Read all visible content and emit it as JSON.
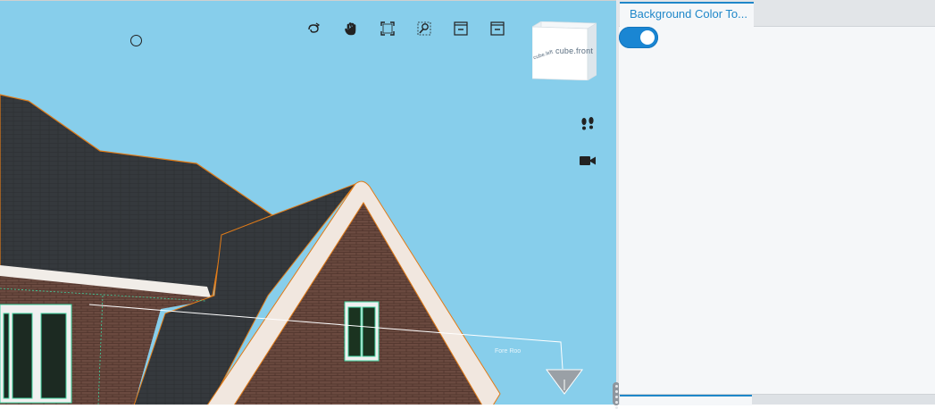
{
  "viewer": {
    "background_color": "#87ceeb",
    "nav_cube": {
      "face_label": "cube.front",
      "side_label": "cube.left"
    },
    "toolbar_icons": [
      "orbit-icon",
      "pan-hand-icon",
      "fit-to-view-icon",
      "zoom-window-icon",
      "explode-left-icon",
      "explode-right-icon"
    ],
    "side_icons": [
      "walk-footsteps-icon",
      "camera-icon"
    ],
    "ghost_label": "Fore Roo"
  },
  "panel": {
    "tab_label": "Background Color To...",
    "toggle_on": true,
    "accent_color": "#1f87c9"
  }
}
